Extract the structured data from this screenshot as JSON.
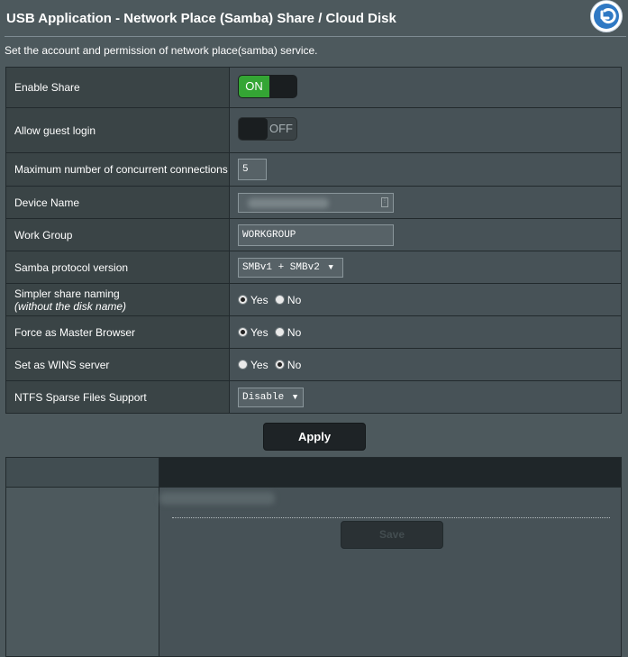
{
  "header": {
    "title": "USB Application - Network Place (Samba) Share / Cloud Disk",
    "back_icon": "back-arrow-icon"
  },
  "description": "Set the account and permission of network place(samba) service.",
  "settings": {
    "enable_share": {
      "label": "Enable Share",
      "state": "ON"
    },
    "guest_login": {
      "label": "Allow guest login",
      "state": "OFF"
    },
    "max_connections": {
      "label": "Maximum number of concurrent connections",
      "value": "5"
    },
    "device_name": {
      "label": "Device Name",
      "value": ""
    },
    "work_group": {
      "label": "Work Group",
      "value": "WORKGROUP"
    },
    "samba_version": {
      "label": "Samba protocol version",
      "selected": "SMBv1 + SMBv2"
    },
    "simpler_naming": {
      "label": "Simpler share naming",
      "sublabel": "(without the disk name)",
      "yes": "Yes",
      "no": "No"
    },
    "master_browser": {
      "label": "Force as Master Browser",
      "yes": "Yes",
      "no": "No"
    },
    "wins_server": {
      "label": "Set as WINS server",
      "yes": "Yes",
      "no": "No"
    },
    "ntfs_sparse": {
      "label": "NTFS Sparse Files Support",
      "selected": "Disable"
    }
  },
  "apply_label": "Apply",
  "save_label": "Save",
  "colors": {
    "background": "#4d595d",
    "on_green": "#34a534",
    "back_button_blue": "#2f79c4"
  }
}
